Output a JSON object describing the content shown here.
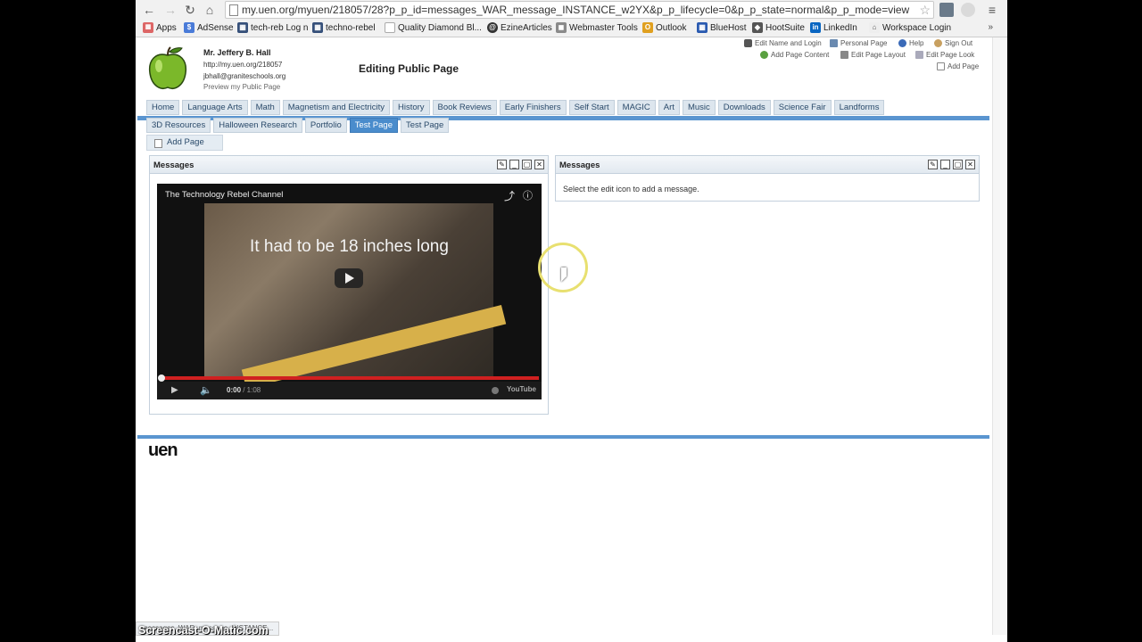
{
  "browser": {
    "url": "my.uen.org/myuen/218057/28?p_p_id=messages_WAR_message_INSTANCE_w2YX&p_p_lifecycle=0&p_p_state=normal&p_p_mode=view",
    "bookmarks": [
      "Apps",
      "AdSense",
      "tech-reb Log n",
      "techno-rebel",
      "Quality Diamond Bl...",
      "EzineArticles",
      "Webmaster Tools",
      "Outlook",
      "BlueHost",
      "HootSuite",
      "LinkedIn",
      "Workspace Login"
    ],
    "bookmarks_more": "»",
    "status_text": "messages_WAR_message_INSTANCE..."
  },
  "header": {
    "user_name": "Mr. Jeffery B. Hall",
    "user_url": "http://my.uen.org/218057",
    "user_email": "jbhall@graniteschools.org",
    "preview_link": "Preview my Public Page",
    "page_heading": "Editing Public Page",
    "top_links": {
      "edit_name": "Edit Name and Login",
      "personal_page": "Personal Page",
      "help": "Help",
      "sign_out": "Sign Out",
      "add_page_content": "Add Page Content",
      "edit_page_layout": "Edit Page Layout",
      "edit_page_look": "Edit Page Look",
      "add_page": "Add Page"
    }
  },
  "tabs": {
    "row1": [
      "Home",
      "Language Arts",
      "Math",
      "Magnetism and Electricity",
      "History",
      "Book Reviews",
      "Early Finishers",
      "Self Start",
      "MAGIC",
      "Art",
      "Music",
      "Downloads",
      "Science Fair",
      "Landforms"
    ],
    "row2": [
      "3D Resources",
      "Halloween Research",
      "Portfolio",
      "Test Page",
      "Test Page"
    ],
    "active_index_row2": 3,
    "add_page": "Add Page"
  },
  "portlets": {
    "left": {
      "title": "Messages",
      "video": {
        "channel": "The Technology Rebel Channel",
        "caption": "It had to be 18 inches long",
        "time_current": "0:00",
        "time_total": " / 1:08",
        "brand": "YouTube"
      }
    },
    "right": {
      "title": "Messages",
      "body": "Select the edit icon to add a message."
    }
  },
  "footer": {
    "logo": "uen"
  },
  "watermark": "Screencast-O-Matic.com",
  "colors": {
    "tab_active": "#4a8ccc",
    "tab_bar": "#5a95d0",
    "video_progress": "#d02020"
  }
}
